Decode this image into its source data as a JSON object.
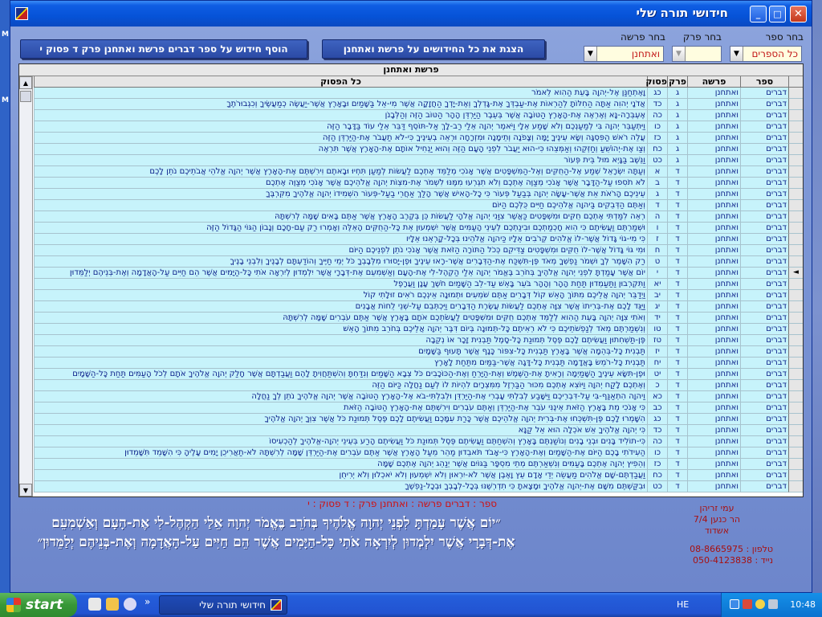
{
  "desktop": {
    "side_marks": [
      "M",
      "M"
    ]
  },
  "window": {
    "title": "חידושי תורה שלי",
    "buttons": {
      "minimize": "_",
      "maximize": "□",
      "close": "✕"
    }
  },
  "filters": {
    "book_label": "בחר ספר",
    "book_value": "כל הספרים",
    "chapter_label": "בחר פרק",
    "chapter_value": "",
    "parsha_label": "בחר פרשה",
    "parsha_value": "ואתחנן"
  },
  "buttons": {
    "show_all": "הצגת את כל החידושים על פרשת ואתחנן",
    "add_new": "הוסף חידוש על ספר דברים פרשת ואתחנן פרק ד פסוק י"
  },
  "grid": {
    "caption": "פרשת ואתחנן",
    "headers": {
      "book": "ספר",
      "parsha": "פרשה",
      "chapter": "פרק",
      "verse": "פסוק",
      "text": "כל הפסוק"
    },
    "selected_marker": "◄",
    "rows": [
      {
        "book": "דברים",
        "parsha": "ואתחנן",
        "ch": "ג",
        "vs": "כג",
        "text": "וָאֶתְחַנַּן אֶל-יְהוָה בָּעֵת הַהִוא לֵאמֹר"
      },
      {
        "book": "דברים",
        "parsha": "ואתחנן",
        "ch": "ג",
        "vs": "כד",
        "text": "אֲדֹנָי יְהוִה אַתָּה הַחִלּוֹתָ לְהַרְאוֹת אֶת-עַבְדְּךָ אֶת-גָּדְלְךָ וְאֶת-יָדְךָ הַחֲזָקָה אֲשֶׁר מִי-אֵל בַּשָּׁמַיִם וּבָאָרֶץ אֲשֶׁר-יַעֲשֶׂה כְמַעֲשֶׂיךָ וְכִגְבוּרֹתֶךָ"
      },
      {
        "book": "דברים",
        "parsha": "ואתחנן",
        "ch": "ג",
        "vs": "כה",
        "text": "אֶעְבְּרָה-נָּא וְאֶרְאֶה אֶת-הָאָרֶץ הַטּוֹבָה אֲשֶׁר בְּעֵבֶר הַיַּרְדֵּן הָהָר הַטּוֹב הַזֶּה וְהַלְּבָנֹן"
      },
      {
        "book": "דברים",
        "parsha": "ואתחנן",
        "ch": "ג",
        "vs": "כו",
        "text": "וַיִּתְעַבֵּר יְהוָה בִּי לְמַעַנְכֶם וְלֹא שָׁמַע אֵלָי וַיֹּאמֶר יְהוָה אֵלַי רַב-לָךְ אַל-תּוֹסֶף דַּבֵּר אֵלַי עוֹד בַּדָּבָר הַזֶּה"
      },
      {
        "book": "דברים",
        "parsha": "ואתחנן",
        "ch": "ג",
        "vs": "כז",
        "text": "עֲלֵה רֹאשׁ הַפִּסְגָּה וְשָׂא עֵינֶיךָ יָמָּה וְצָפֹנָה וְתֵימָנָה וּמִזְרָחָה וּרְאֵה בְעֵינֶיךָ כִּי-לֹא תַעֲבֹר אֶת-הַיַּרְדֵּן הַזֶּה"
      },
      {
        "book": "דברים",
        "parsha": "ואתחנן",
        "ch": "ג",
        "vs": "כח",
        "text": "וְצַו אֶת-יְהוֹשֻׁעַ וְחַזְּקֵהוּ וְאַמְּצֵהוּ כִּי-הוּא יַעֲבֹר לִפְנֵי הָעָם הַזֶּה וְהוּא יַנְחִיל אוֹתָם אֶת-הָאָרֶץ אֲשֶׁר תִּרְאֶה"
      },
      {
        "book": "דברים",
        "parsha": "ואתחנן",
        "ch": "ג",
        "vs": "כט",
        "text": "וַנֵּשֶׁב בַּגָּיְא מוּל בֵּית פְּעוֹר"
      },
      {
        "book": "דברים",
        "parsha": "ואתחנן",
        "ch": "ד",
        "vs": "א",
        "text": "וְעַתָּה יִשְׂרָאֵל שְׁמַע אֶל-הַחֻקִּים וְאֶל-הַמִּשְׁפָּטִים אֲשֶׁר אָנֹכִי מְלַמֵּד אֶתְכֶם לַעֲשׂוֹת לְמַעַן תִּחְיוּ וּבָאתֶם וִירִשְׁתֶּם אֶת-הָאָרֶץ אֲשֶׁר יְהוָה אֱלֹהֵי אֲבֹתֵיכֶם נֹתֵן לָכֶם"
      },
      {
        "book": "דברים",
        "parsha": "ואתחנן",
        "ch": "ד",
        "vs": "ב",
        "text": "לֹא תֹסִפוּ עַל-הַדָּבָר אֲשֶׁר אָנֹכִי מְצַוֶּה אֶתְכֶם וְלֹא תִגְרְעוּ מִמֶּנּוּ לִשְׁמֹר אֶת-מִצְוֹת יְהוָה אֱלֹהֵיכֶם אֲשֶׁר אָנֹכִי מְצַוֶּה אֶתְכֶם"
      },
      {
        "book": "דברים",
        "parsha": "ואתחנן",
        "ch": "ד",
        "vs": "ג",
        "text": "עֵינֵיכֶם הָרֹאֹת אֵת אֲשֶׁר-עָשָׂה יְהוָה בְּבַעַל פְּעוֹר כִּי כָל-הָאִישׁ אֲשֶׁר הָלַךְ אַחֲרֵי בַעַל-פְּעוֹר הִשְׁמִידוֹ יְהוָה אֱלֹהֶיךָ מִקִּרְבֶּךָ"
      },
      {
        "book": "דברים",
        "parsha": "ואתחנן",
        "ch": "ד",
        "vs": "ד",
        "text": "וְאַתֶּם הַדְּבֵקִים בַּיהוָה אֱלֹהֵיכֶם חַיִּים כֻּלְּכֶם הַיּוֹם"
      },
      {
        "book": "דברים",
        "parsha": "ואתחנן",
        "ch": "ד",
        "vs": "ה",
        "text": "רְאֵה לִמַּדְתִּי אֶתְכֶם חֻקִּים וּמִשְׁפָּטִים כַּאֲשֶׁר צִוַּנִי יְהוָה אֱלֹהָי לַעֲשׂוֹת כֵּן בְּקֶרֶב הָאָרֶץ אֲשֶׁר אַתֶּם בָּאִים שָׁמָּה לְרִשְׁתָּהּ"
      },
      {
        "book": "דברים",
        "parsha": "ואתחנן",
        "ch": "ד",
        "vs": "ו",
        "text": "וּשְׁמַרְתֶּם וַעֲשִׂיתֶם כִּי הִוא חָכְמַתְכֶם וּבִינַתְכֶם לְעֵינֵי הָעַמִּים אֲשֶׁר יִשְׁמְעוּן אֵת כָּל-הַחֻקִּים הָאֵלֶּה וְאָמְרוּ רַק עַם-חָכָם וְנָבוֹן הַגּוֹי הַגָּדוֹל הַזֶּה"
      },
      {
        "book": "דברים",
        "parsha": "ואתחנן",
        "ch": "ד",
        "vs": "ז",
        "text": "כִּי מִי-גוֹי גָּדוֹל אֲשֶׁר-לוֹ אֱלֹהִים קְרֹבִים אֵלָיו כַּיהוָה אֱלֹהֵינוּ בְּכָל-קָרְאֵנוּ אֵלָיו"
      },
      {
        "book": "דברים",
        "parsha": "ואתחנן",
        "ch": "ד",
        "vs": "ח",
        "text": "וּמִי גּוֹי גָּדוֹל אֲשֶׁר-לוֹ חֻקִּים וּמִשְׁפָּטִים צַדִּיקִם כְּכֹל הַתּוֹרָה הַזֹּאת אֲשֶׁר אָנֹכִי נֹתֵן לִפְנֵיכֶם הַיּוֹם"
      },
      {
        "book": "דברים",
        "parsha": "ואתחנן",
        "ch": "ד",
        "vs": "ט",
        "text": "רַק הִשָּׁמֶר לְךָ וּשְׁמֹר נַפְשְׁךָ מְאֹד פֶּן-תִּשְׁכַּח אֶת-הַדְּבָרִים אֲשֶׁר-רָאוּ עֵינֶיךָ וּפֶן-יָסוּרוּ מִלְּבָבְךָ כֹּל יְמֵי חַיֶּיךָ וְהוֹדַעְתָּם לְבָנֶיךָ וְלִבְנֵי בָנֶיךָ"
      },
      {
        "book": "דברים",
        "parsha": "ואתחנן",
        "ch": "ד",
        "vs": "י",
        "text": "יוֹם אֲשֶׁר עָמַדְתָּ לִפְנֵי יְהוָה אֱלֹהֶיךָ בְּחֹרֵב בֶּאֱמֹר יְהוָה אֵלַי הַקְהֶל-לִי אֶת-הָעָם וְאַשְׁמִעֵם אֶת-דְּבָרָי אֲשֶׁר יִלְמְדוּן לְיִרְאָה אֹתִי כָּל-הַיָּמִים אֲשֶׁר הֵם חַיִּים עַל-הָאֲדָמָה וְאֶת-בְּנֵיהֶם יְלַמֵּדוּן",
        "selected": true
      },
      {
        "book": "דברים",
        "parsha": "ואתחנן",
        "ch": "ד",
        "vs": "יא",
        "text": "וַתִּקְרְבוּן וַתַּעַמְדוּן תַּחַת הָהָר וְהָהָר בֹּעֵר בָּאֵשׁ עַד-לֵב הַשָּׁמַיִם חֹשֶׁךְ עָנָן וַעֲרָפֶל"
      },
      {
        "book": "דברים",
        "parsha": "ואתחנן",
        "ch": "ד",
        "vs": "יב",
        "text": "וַיְדַבֵּר יְהוָה אֲלֵיכֶם מִתּוֹךְ הָאֵשׁ קוֹל דְּבָרִים אַתֶּם שֹׁמְעִים וּתְמוּנָה אֵינְכֶם רֹאִים זוּלָתִי קוֹל"
      },
      {
        "book": "דברים",
        "parsha": "ואתחנן",
        "ch": "ד",
        "vs": "יג",
        "text": "וַיַּגֵּד לָכֶם אֶת-בְּרִיתוֹ אֲשֶׁר צִוָּה אֶתְכֶם לַעֲשׂוֹת עֲשֶׂרֶת הַדְּבָרִים וַיִּכְתְּבֵם עַל-שְׁנֵי לֻחוֹת אֲבָנִים"
      },
      {
        "book": "דברים",
        "parsha": "ואתחנן",
        "ch": "ד",
        "vs": "יד",
        "text": "וְאֹתִי צִוָּה יְהוָה בָּעֵת הַהִוא לְלַמֵּד אֶתְכֶם חֻקִּים וּמִשְׁפָּטִים לַעֲשֹׂתְכֶם אֹתָם בָּאָרֶץ אֲשֶׁר אַתֶּם עֹבְרִים שָׁמָּה לְרִשְׁתָּהּ"
      },
      {
        "book": "דברים",
        "parsha": "ואתחנן",
        "ch": "ד",
        "vs": "טו",
        "text": "וְנִשְׁמַרְתֶּם מְאֹד לְנַפְשֹׁתֵיכֶם כִּי לֹא רְאִיתֶם כָּל-תְּמוּנָה בְּיוֹם דִּבֶּר יְהוָה אֲלֵיכֶם בְּחֹרֵב מִתּוֹךְ הָאֵשׁ"
      },
      {
        "book": "דברים",
        "parsha": "ואתחנן",
        "ch": "ד",
        "vs": "טז",
        "text": "פֶּן-תַּשְׁחִתוּן וַעֲשִׂיתֶם לָכֶם פֶּסֶל תְּמוּנַת כָּל-סָמֶל תַּבְנִית זָכָר אוֹ נְקֵבָה"
      },
      {
        "book": "דברים",
        "parsha": "ואתחנן",
        "ch": "ד",
        "vs": "יז",
        "text": "תַּבְנִית כָּל-בְּהֵמָה אֲשֶׁר בָּאָרֶץ תַּבְנִית כָּל-צִפּוֹר כָּנָף אֲשֶׁר תָּעוּף בַּשָּׁמָיִם"
      },
      {
        "book": "דברים",
        "parsha": "ואתחנן",
        "ch": "ד",
        "vs": "יח",
        "text": "תַּבְנִית כָּל-רֹמֵשׂ בָּאֲדָמָה תַּבְנִית כָּל-דָּגָה אֲשֶׁר-בַּמַּיִם מִתַּחַת לָאָרֶץ"
      },
      {
        "book": "דברים",
        "parsha": "ואתחנן",
        "ch": "ד",
        "vs": "יט",
        "text": "וּפֶן-תִּשָּׂא עֵינֶיךָ הַשָּׁמַיְמָה וְרָאִיתָ אֶת-הַשֶּׁמֶשׁ וְאֶת-הַיָּרֵחַ וְאֶת-הַכּוֹכָבִים כֹּל צְבָא הַשָּׁמַיִם וְנִדַּחְתָּ וְהִשְׁתַּחֲוִיתָ לָהֶם וַעֲבַדְתָּם אֲשֶׁר חָלַק יְהוָה אֱלֹהֶיךָ אֹתָם לְכֹל הָעַמִּים תַּחַת כָּל-הַשָּׁמָיִם"
      },
      {
        "book": "דברים",
        "parsha": "ואתחנן",
        "ch": "ד",
        "vs": "כ",
        "text": "וְאֶתְכֶם לָקַח יְהוָה וַיּוֹצִא אֶתְכֶם מִכּוּר הַבַּרְזֶל מִמִּצְרָיִם לִהְיוֹת לוֹ לְעַם נַחֲלָה כַּיּוֹם הַזֶּה"
      },
      {
        "book": "דברים",
        "parsha": "ואתחנן",
        "ch": "ד",
        "vs": "כא",
        "text": "וַיהוָה הִתְאַנַּף-בִּי עַל-דִּבְרֵיכֶם וַיִּשָּׁבַע לְבִלְתִּי עָבְרִי אֶת-הַיַּרְדֵּן וּלְבִלְתִּי-בֹא אֶל-הָאָרֶץ הַטּוֹבָה אֲשֶׁר יְהוָה אֱלֹהֶיךָ נֹתֵן לְךָ נַחֲלָה"
      },
      {
        "book": "דברים",
        "parsha": "ואתחנן",
        "ch": "ד",
        "vs": "כב",
        "text": "כִּי אָנֹכִי מֵת בָּאָרֶץ הַזֹּאת אֵינֶנִּי עֹבֵר אֶת-הַיַּרְדֵּן וְאַתֶּם עֹבְרִים וִירִשְׁתֶּם אֶת-הָאָרֶץ הַטּוֹבָה הַזֹּאת"
      },
      {
        "book": "דברים",
        "parsha": "ואתחנן",
        "ch": "ד",
        "vs": "כג",
        "text": "הִשָּׁמְרוּ לָכֶם פֶּן-תִּשְׁכְּחוּ אֶת-בְּרִית יְהוָה אֱלֹהֵיכֶם אֲשֶׁר כָּרַת עִמָּכֶם וַעֲשִׂיתֶם לָכֶם פֶּסֶל תְּמוּנַת כֹּל אֲשֶׁר צִוְּךָ יְהוָה אֱלֹהֶיךָ"
      },
      {
        "book": "דברים",
        "parsha": "ואתחנן",
        "ch": "ד",
        "vs": "כד",
        "text": "כִּי יְהוָה אֱלֹהֶיךָ אֵשׁ אֹכְלָה הוּא אֵל קַנָּא"
      },
      {
        "book": "דברים",
        "parsha": "ואתחנן",
        "ch": "ד",
        "vs": "כה",
        "text": "כִּי-תוֹלִיד בָּנִים וּבְנֵי בָנִים וְנוֹשַׁנְתֶּם בָּאָרֶץ וְהִשְׁחַתֶּם וַעֲשִׂיתֶם פֶּסֶל תְּמוּנַת כֹּל וַעֲשִׂיתֶם הָרַע בְּעֵינֵי יְהוָה-אֱלֹהֶיךָ לְהַכְעִיסוֹ"
      },
      {
        "book": "דברים",
        "parsha": "ואתחנן",
        "ch": "ד",
        "vs": "כו",
        "text": "הַעִידֹתִי בָכֶם הַיּוֹם אֶת-הַשָּׁמַיִם וְאֶת-הָאָרֶץ כִּי-אָבֹד תֹּאבֵדוּן מַהֵר מֵעַל הָאָרֶץ אֲשֶׁר אַתֶּם עֹבְרִים אֶת-הַיַּרְדֵּן שָׁמָּה לְרִשְׁתָּהּ לֹא-תַאֲרִיכֻן יָמִים עָלֶיהָ כִּי הִשָּׁמֵד תִּשָּׁמֵדוּן"
      },
      {
        "book": "דברים",
        "parsha": "ואתחנן",
        "ch": "ד",
        "vs": "כז",
        "text": "וְהֵפִיץ יְהוָה אֶתְכֶם בָּעַמִּים וְנִשְׁאַרְתֶּם מְתֵי מִסְפָּר בַּגּוֹיִם אֲשֶׁר יְנַהֵג יְהוָה אֶתְכֶם שָׁמָּה"
      },
      {
        "book": "דברים",
        "parsha": "ואתחנן",
        "ch": "ד",
        "vs": "כח",
        "text": "וַעֲבַדְתֶּם-שָׁם אֱלֹהִים מַעֲשֵׂה יְדֵי אָדָם עֵץ וָאֶבֶן אֲשֶׁר לֹא-יִרְאוּן וְלֹא יִשְׁמְעוּן וְלֹא יֹאכְלוּן וְלֹא יְרִיחֻן"
      },
      {
        "book": "דברים",
        "parsha": "ואתחנן",
        "ch": "ד",
        "vs": "כט",
        "text": "וּבִקַּשְׁתֶּם מִשָּׁם אֶת-יְהוָה אֱלֹהֶיךָ וּמָצָאתָ כִּי תִדְרְשֶׁנּוּ בְּכָל-לְבָבְךָ וּבְכָל-נַפְשֶׁךָ"
      }
    ]
  },
  "current": {
    "line": "ספר : דברים   פרשה : ואתחנן      פרק : ד   פסוק : י",
    "verse": "״יוֹם אֲשֶׁר עָמַדְתָּ לִפְנֵי יְהוָה אֱלֹהֶיךָ בְּחֹרֵב בֶּאֱמֹר יְהוָה אֵלַי הַקְהֶל-לִי אֶת-הָעָם וְאַשְׁמִעֵם אֶת-דְּבָרָי אֲשֶׁר יִלְמְדוּן לְיִרְאָה אֹתִי כָּל-הַיָּמִים אֲשֶׁר הֵם חַיִּים עַל-הָאֲדָמָה וְאֶת-בְּנֵיהֶם יְלַמֵּדוּן״"
  },
  "author": {
    "name": "עמי זריהן",
    "street": "הר כנען 7/4",
    "city": "אשדוד",
    "phone": "טלפון : 08-8665975",
    "mobile": "נייד : 050-4123838"
  },
  "taskbar": {
    "start": "start",
    "task_title": "חידושי תורה שלי",
    "lang": "HE",
    "clock": "10:48",
    "more": "»"
  },
  "colors": {
    "titlebar": "#0653d8",
    "grid_row": "#c7f3fb",
    "highlight_text": "#c21616"
  }
}
